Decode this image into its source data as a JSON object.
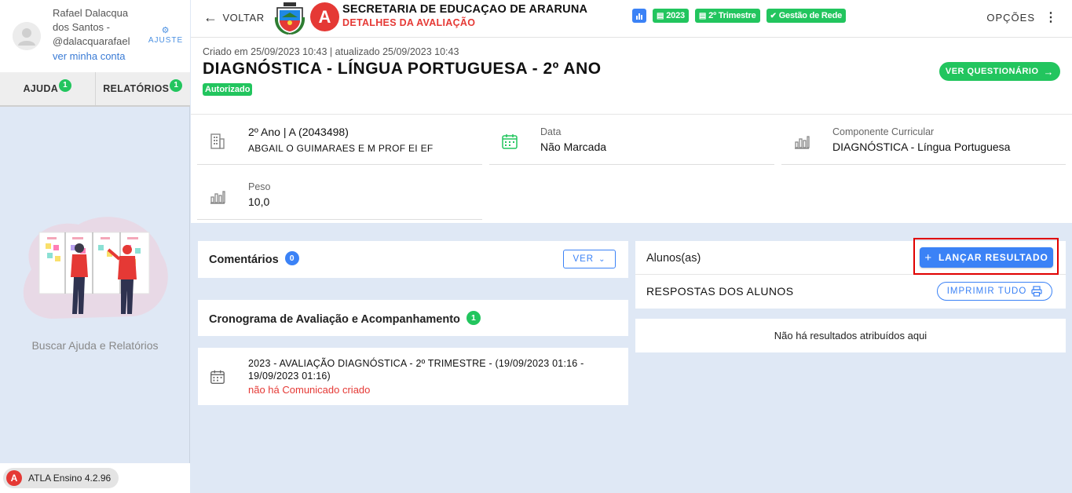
{
  "sidebar": {
    "user_name": "Rafael Dalacqua dos Santos - @dalacquarafael",
    "account_link": "ver minha conta",
    "ajuste_label": "AJUSTE",
    "tabs": [
      {
        "label": "AJUDA",
        "count": "1"
      },
      {
        "label": "RELATÓRIOS",
        "count": "1"
      }
    ],
    "help_text": "Buscar Ajuda e Relatórios",
    "version": "ATLA Ensino 4.2.96"
  },
  "topbar": {
    "back_label": "VOLTAR",
    "title": "SECRETARIA DE EDUCAÇAO DE ARARUNA",
    "subtitle": "DETALHES DA AVALIAÇÃO",
    "chips": [
      "2023",
      "2º Trimestre",
      "Gestão de Rede"
    ],
    "options_label": "OPÇÕES",
    "logo_letter": "A"
  },
  "header": {
    "meta": "Criado em 25/09/2023 10:43 | atualizado 25/09/2023 10:43",
    "title": "DIAGNÓSTICA - LÍNGUA PORTUGUESA - 2º ANO",
    "status": "Autorizado",
    "questionnaire_button": "VER QUESTIONÁRIO"
  },
  "info": {
    "class_line1": "2º Ano | A (2043498)",
    "class_line2": "ABGAIL O GUIMARAES E M PROF EI EF",
    "date_label": "Data",
    "date_value": "Não Marcada",
    "component_label": "Componente Curricular",
    "component_value": "DIAGNÓSTICA - Língua Portuguesa",
    "weight_label": "Peso",
    "weight_value": "10,0"
  },
  "comments": {
    "title": "Comentários",
    "count": "0",
    "view_button": "VER"
  },
  "schedule": {
    "title": "Cronograma de Avaliação e Acompanhamento",
    "count": "1",
    "item_text": "2023 - AVALIAÇÃO DIAGNÓSTICA - 2º TRIMESTRE - (19/09/2023 01:16 - 19/09/2023 01:16)",
    "item_note": "não há Comunicado criado"
  },
  "students": {
    "title": "Alunos(as)",
    "launch_button": "LANÇAR RESULTADO",
    "answers_label": "RESPOSTAS DOS ALUNOS",
    "print_button": "IMPRIMIR TUDO",
    "empty_text": "Não há resultados atribuídos aqui"
  },
  "colors": {
    "accent_blue": "#3b82f6",
    "success_green": "#22c55e",
    "brand_red": "#e53935",
    "highlight_red": "#e00000"
  }
}
